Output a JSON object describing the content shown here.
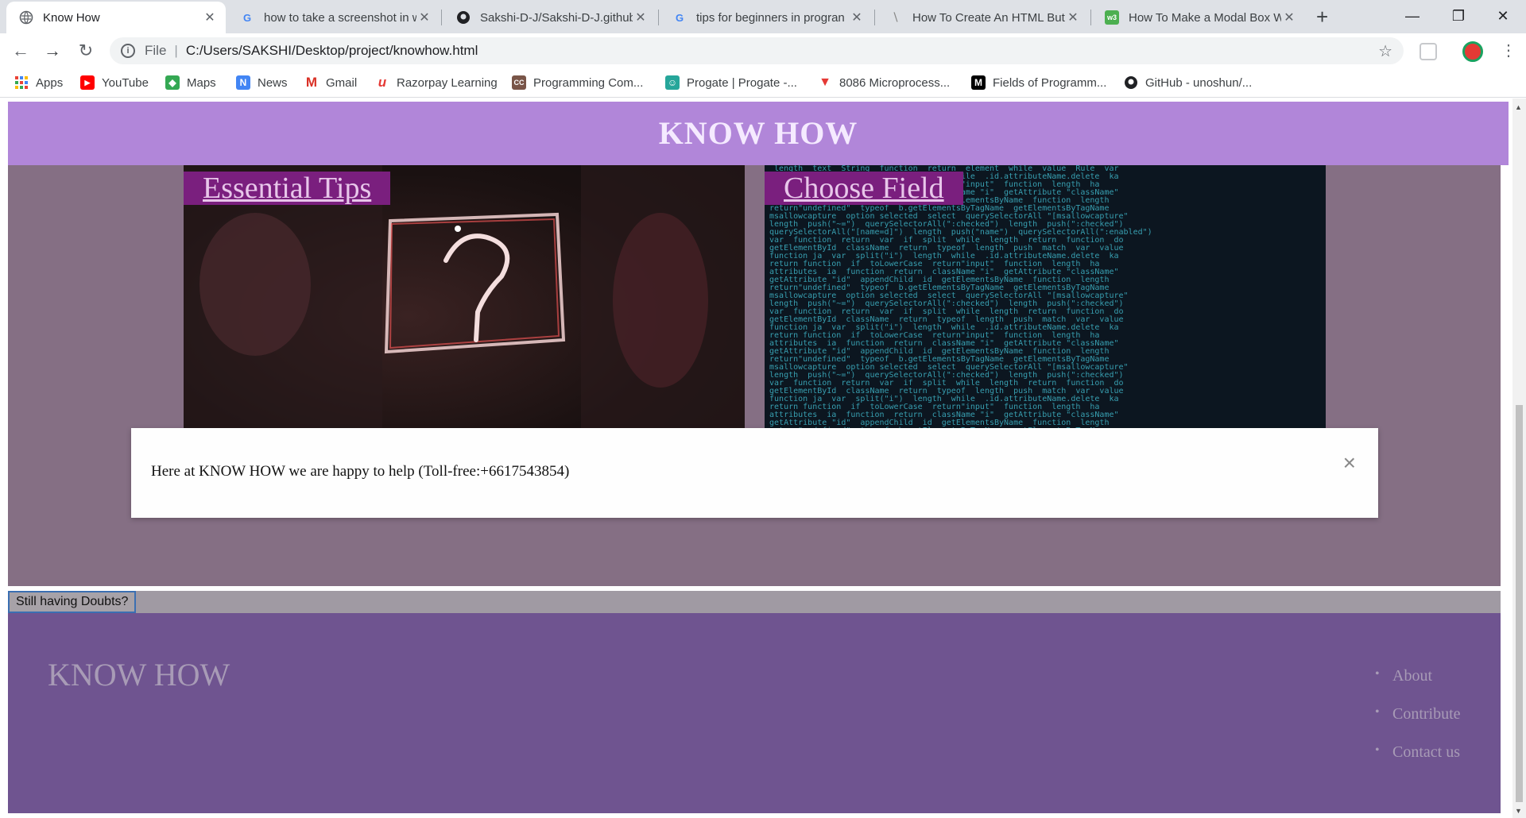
{
  "browser": {
    "tabs": [
      {
        "title": "Know How",
        "icon": "globe-icon",
        "active": true
      },
      {
        "title": "how to take a screenshot in w",
        "icon": "google-icon",
        "active": false
      },
      {
        "title": "Sakshi-D-J/Sakshi-D-J.github",
        "icon": "github-icon",
        "active": false
      },
      {
        "title": "tips for beginners in progran",
        "icon": "google-icon",
        "active": false
      },
      {
        "title": "How To Create An HTML But",
        "icon": "w3schools-icon",
        "active": false
      },
      {
        "title": "How To Make a Modal Box W",
        "icon": "w3schools-green-icon",
        "active": false
      }
    ],
    "address": {
      "scheme": "File",
      "url": "C:/Users/SAKSHI/Desktop/project/knowhow.html"
    },
    "bookmarks": [
      {
        "label": "Apps",
        "icon": "apps-grid-icon",
        "color": "#1a73e8"
      },
      {
        "label": "YouTube",
        "icon": "youtube-icon",
        "color": "#ff0000"
      },
      {
        "label": "Maps",
        "icon": "maps-icon",
        "color": "#34a853"
      },
      {
        "label": "News",
        "icon": "news-icon",
        "color": "#4285f4"
      },
      {
        "label": "Gmail",
        "icon": "gmail-icon",
        "color": "#d93025"
      },
      {
        "label": "Razorpay Learning",
        "icon": "razorpay-icon",
        "color": "#e53935"
      },
      {
        "label": "Programming Com...",
        "icon": "cc-icon",
        "color": "#795548"
      },
      {
        "label": "Progate | Progate -...",
        "icon": "progate-icon",
        "color": "#26a69a"
      },
      {
        "label": "8086 Microprocess...",
        "icon": "8086-icon",
        "color": "#e53935"
      },
      {
        "label": "Fields of Programm...",
        "icon": "medium-icon",
        "color": "#000000"
      },
      {
        "label": "GitHub - unoshun/...",
        "icon": "github-icon",
        "color": "#000000"
      }
    ]
  },
  "page": {
    "title": "KNOW HOW",
    "cards": [
      {
        "label": "Essential Tips"
      },
      {
        "label": "Choose Field"
      }
    ],
    "doubts_button": "Still having Doubts?",
    "footer": {
      "title": "KNOW HOW",
      "links": [
        "About",
        "Contribute",
        "Contact us"
      ]
    },
    "modal": {
      "text": "Here at KNOW HOW we are happy to help (Toll-free:+6617543854)",
      "close": "×"
    }
  },
  "colors": {
    "header_bg": "#b186d9",
    "content_bg": "#856f84",
    "footer_bg": "#6f5490",
    "card_label_bg": "#7a1f7e"
  }
}
